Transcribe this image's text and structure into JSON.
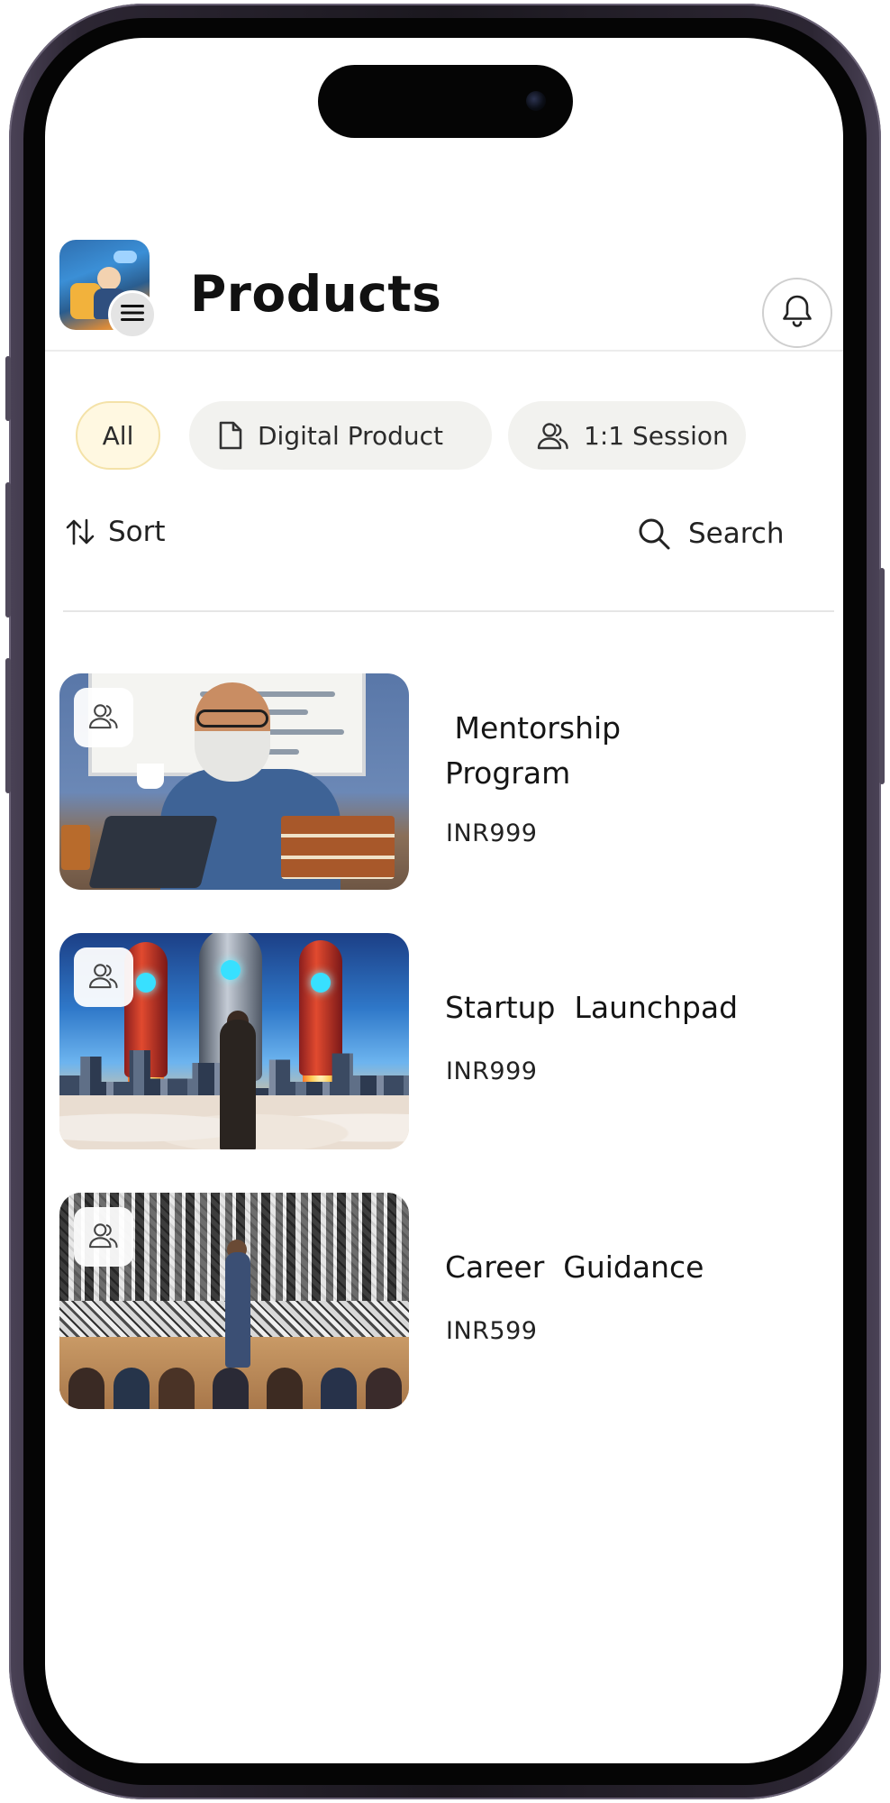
{
  "header": {
    "title": "Products"
  },
  "filters": {
    "chips": [
      {
        "label": "All",
        "icon": "",
        "selected": true
      },
      {
        "label": "Digital Product",
        "icon": "document-icon",
        "selected": false
      },
      {
        "label": "1:1 Session",
        "icon": "users-icon",
        "selected": false
      }
    ]
  },
  "toolbar": {
    "sort_label": "Sort",
    "search_label": "Search"
  },
  "products": [
    {
      "title_line1": " Mentorship",
      "title_line2": "Program",
      "price": "INR999",
      "badge_icon": "users-icon"
    },
    {
      "title_line1": "Startup  Launchpad",
      "title_line2": "",
      "price": "INR999",
      "badge_icon": "users-icon"
    },
    {
      "title_line1": "Career  Guidance",
      "title_line2": "",
      "price": "INR599",
      "badge_icon": "users-icon"
    }
  ],
  "colors": {
    "selected_chip_bg": "#fff8e1",
    "chip_bg": "#f2f2ef",
    "text": "#111111"
  }
}
